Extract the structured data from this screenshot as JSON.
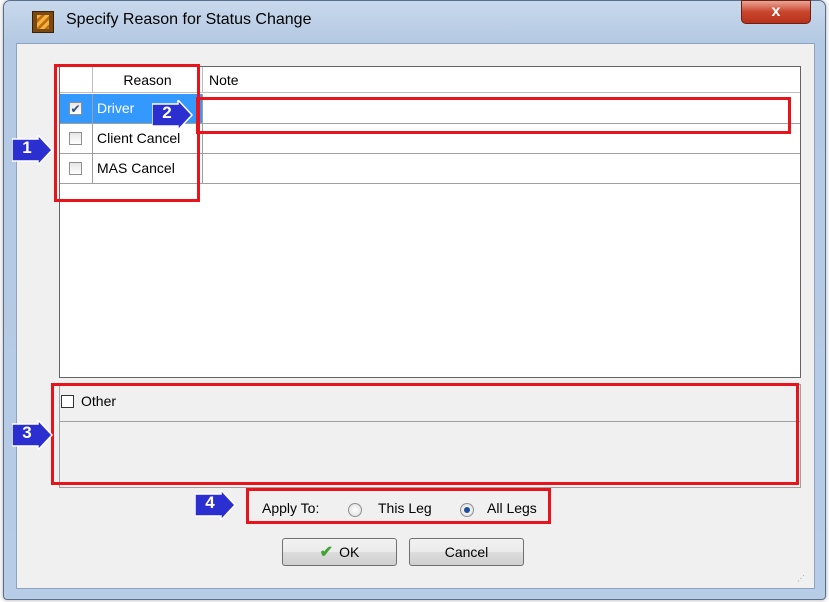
{
  "window": {
    "title": "Specify Reason for Status Change",
    "close_label": "x"
  },
  "grid": {
    "columns": [
      "Reason",
      "Note"
    ],
    "rows": [
      {
        "reason": "Driver",
        "note": "",
        "checked": true,
        "selected": true
      },
      {
        "reason": "Client Cancel",
        "note": "",
        "checked": false,
        "selected": false
      },
      {
        "reason": "MAS Cancel",
        "note": "",
        "checked": false,
        "selected": false
      }
    ]
  },
  "other": {
    "label": "Other",
    "checked": false,
    "text_value": ""
  },
  "apply_to": {
    "label": "Apply To:",
    "options": [
      {
        "label": "This Leg",
        "selected": false
      },
      {
        "label": "All Legs",
        "selected": true
      }
    ]
  },
  "buttons": {
    "ok_label": "OK",
    "cancel_label": "Cancel"
  },
  "callouts": {
    "c1": "1",
    "c2": "2",
    "c3": "3",
    "c4": "4"
  },
  "colors": {
    "annotation_red": "#e8141c",
    "callout_blue": "#2c2fd0",
    "selection_blue": "#3399ff"
  }
}
